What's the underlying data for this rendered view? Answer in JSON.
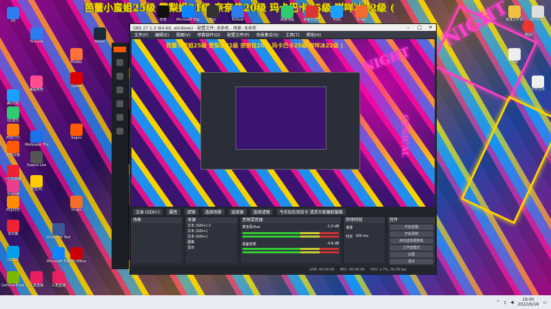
{
  "desktop": {
    "overlay_title": "芭蕾小蛮姐25级 雪梨姐21级 奈奈佳20级 玛卡巴卡25级 咩咩冰22级 (",
    "bottom_banner": "今天钻石双倍卡 请求大家踊跃猫猫",
    "icons_left": [
      {
        "label": "VV"
      },
      {
        "label": "腾讯QQ"
      },
      {
        "label": "QQ音乐"
      },
      {
        "label": "阿里巴巴"
      },
      {
        "label": "阿里云盘"
      },
      {
        "label": "UU加速器"
      },
      {
        "label": "全民K歌"
      },
      {
        "label": "阿里旺旺"
      },
      {
        "label": "向日葵"
      },
      {
        "label": "QQ飞车"
      },
      {
        "label": "Geforce Experience"
      }
    ],
    "icons_col2": [
      {
        "label": "Tencent"
      },
      {
        "label": "美图秀秀"
      },
      {
        "label": "Wallpaper Engine"
      },
      {
        "label": "Xiaomi Lite"
      },
      {
        "label": "阿里UU"
      },
      {
        "label": "Ghostbot Toolkit"
      },
      {
        "label": "Microsoft Edge"
      },
      {
        "label": "三角直播"
      }
    ],
    "icons_col3": [
      {
        "label": "Firefox"
      },
      {
        "label": "Opera"
      },
      {
        "label": "Sogou"
      },
      {
        "label": "Origin"
      },
      {
        "label": "WPS Office"
      },
      {
        "label": "Steam"
      },
      {
        "label": "三角直播"
      }
    ],
    "icons_top": [
      {
        "label": "抖音"
      },
      {
        "label": "Microsoft Edge"
      },
      {
        "label": "Epic"
      },
      {
        "label": "ToDesk"
      },
      {
        "label": "高德地图"
      },
      {
        "label": "网易云音乐"
      },
      {
        "label": "FQQ"
      },
      {
        "label": "Origin"
      }
    ],
    "icons_right": [
      {
        "label": "新建文件夹"
      },
      {
        "label": "Windows"
      },
      {
        "label": "截图"
      },
      {
        "label": "文档"
      },
      {
        "label": "打开文件"
      }
    ]
  },
  "obs": {
    "title": "OBS 27.1.3 (64-bit, windows) - 配置文件: 未命名 - 场景: 未命名",
    "menu": [
      "文件(F)",
      "编辑(E)",
      "视图(V)",
      "停靠部件(D)",
      "配置文件(P)",
      "场景集合(S)",
      "工具(T)",
      "帮助(H)"
    ],
    "preview_overlay": "芭蕾小蛮姐25级 雪梨姐21级 奈奈佳20级 玛卡巴卡25级 咩咩冰22级 (",
    "night": "NIGHT",
    "cynical": "CYNICAL",
    "scene_tabs": [
      "文本 (GDI+)",
      "属性",
      "滤镜",
      "选择场景",
      "选择源",
      "选择滤镜",
      "今天钻石双倍卡 请求大家踊跃猫猫"
    ],
    "docks": {
      "scenes": {
        "title": "场景"
      },
      "sources": {
        "title": "来源",
        "items": [
          "文本 (GDI+) 2",
          "文本 (GDI+)",
          "文本 (GDI+)",
          "图像",
          "显示"
        ]
      },
      "mixer": {
        "title": "音频混音器",
        "channels": [
          {
            "name": "麦克风/Aux",
            "db": "-1.0 dB"
          },
          {
            "name": "桌面音频",
            "db": "-4.8 dB"
          }
        ]
      },
      "transitions": {
        "title": "转场特效",
        "type": "渐变",
        "duration_label": "时长",
        "duration": "300 ms"
      },
      "controls": {
        "title": "控件",
        "buttons": [
          "开始直播",
          "开始录制",
          "启动虚拟摄像机",
          "工作室模式",
          "设置",
          "退出"
        ]
      }
    },
    "status": [
      "LIVE: 00:00:00",
      "REC: 00:00:00",
      "CPU: 2.7%, 30.00 fps"
    ]
  },
  "taskbar": {
    "time": "19:00",
    "date": "2022/6/18"
  }
}
